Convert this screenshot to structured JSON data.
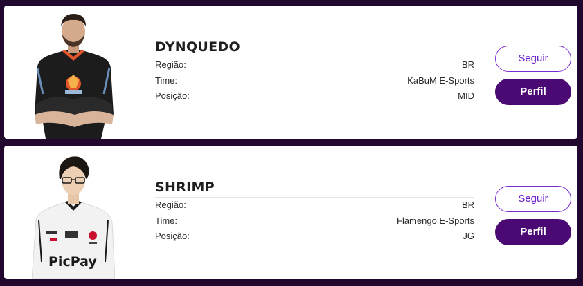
{
  "labels": {
    "region": "Região:",
    "team": "Time:",
    "position": "Posição:"
  },
  "players": [
    {
      "name": "DYNQUEDO",
      "region": "BR",
      "team": "KaBuM E-Sports",
      "position": "MID",
      "follow_label": "Seguir",
      "profile_label": "Perfil"
    },
    {
      "name": "SHRIMP",
      "region": "BR",
      "team": "Flamengo E-Sports",
      "position": "JG",
      "follow_label": "Seguir",
      "profile_label": "Perfil",
      "jersey_sponsor": "PicPay"
    }
  ],
  "colors": {
    "background": "#22082f",
    "follow_border": "#7a2ad1",
    "profile_bg": "#4b0a73"
  }
}
